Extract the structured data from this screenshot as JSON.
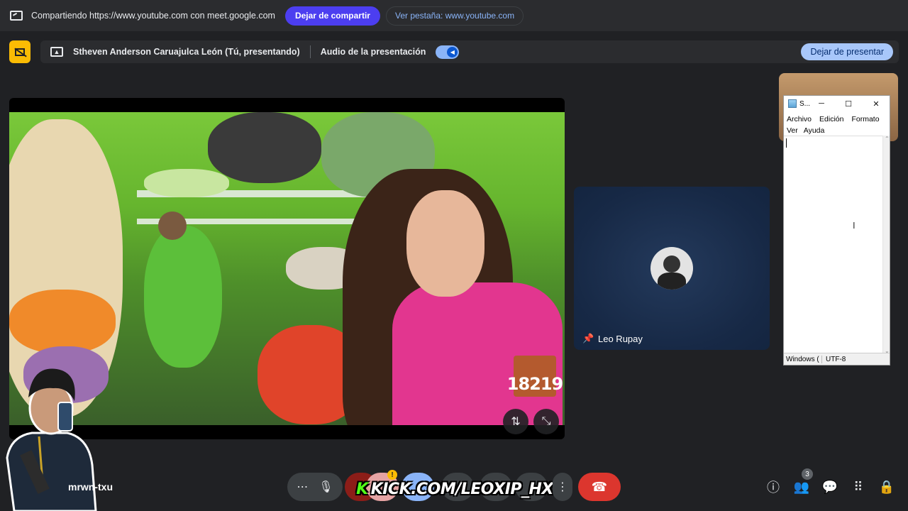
{
  "share_bar": {
    "message": "Compartiendo https://www.youtube.com con meet.google.com",
    "stop_sharing_label": "Dejar de compartir",
    "view_tab_label": "Ver pestaña: www.youtube.com"
  },
  "present_bar": {
    "presenter": "Stheven Anderson Caruajulca León (Tú, presentando)",
    "audio_label": "Audio de la presentación",
    "audio_on": true,
    "stop_presenting_label": "Dejar de presentar"
  },
  "main_video": {
    "overlay_number": "18219"
  },
  "participants": [
    {
      "name": "Leo Rupay"
    }
  ],
  "self": {
    "name": "mrwn-txu"
  },
  "notepad": {
    "title": "S...",
    "menu": [
      "Archivo",
      "Edición",
      "Formato",
      "Ver",
      "Ayuda"
    ],
    "status_line_ending": "Windows (",
    "status_encoding": "UTF-8"
  },
  "overlay_banner": {
    "k_letter": "K",
    "text": "KICK.COM/LEOXIP_HX"
  },
  "people_count": "3",
  "colors": {
    "background": "#202124",
    "share_button": "#4c3ef0",
    "stop_present": "#a8c7fa",
    "hangup": "#dc362e",
    "presenting_indicator": "#fbbc04"
  },
  "icons": {
    "share": "cast-icon",
    "presenting": "presentation-off-icon",
    "mic": "microphone-icon",
    "more": "more-horizontal-icon",
    "hangup": "phone-hangup-icon",
    "info": "info-icon",
    "people": "people-icon",
    "chat": "chat-icon",
    "activities": "apps-grid-icon",
    "host_controls": "lock-person-icon"
  }
}
